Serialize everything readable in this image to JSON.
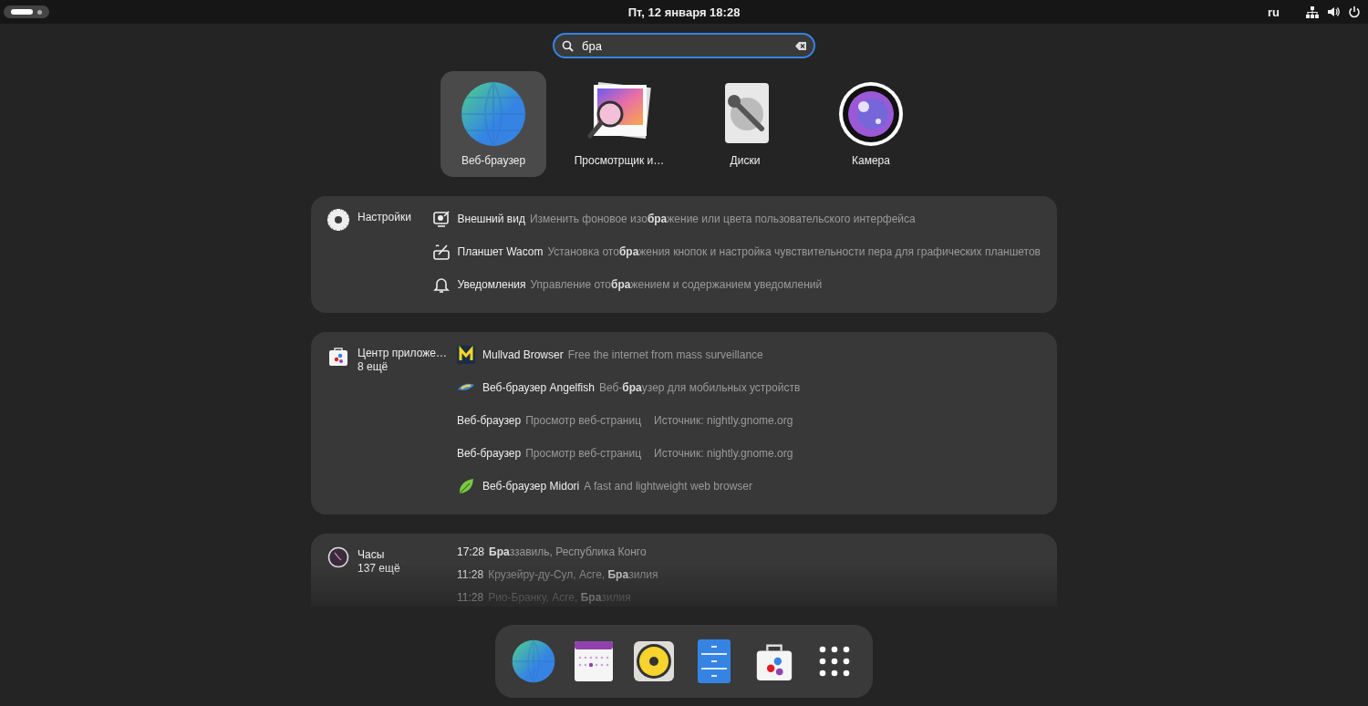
{
  "top_bar": {
    "clock": "Пт, 12 января  18:28",
    "keyboard": "ru"
  },
  "search": {
    "value": "бра"
  },
  "apps": [
    {
      "name": "Веб-браузер",
      "kind": "globe",
      "selected": true
    },
    {
      "name": "Просмотрщик и…",
      "kind": "image",
      "selected": false
    },
    {
      "name": "Диски",
      "kind": "disk",
      "selected": false
    },
    {
      "name": "Камера",
      "kind": "camera",
      "selected": false
    }
  ],
  "sections": [
    {
      "kind": "gear",
      "title": "Настройки",
      "results": [
        {
          "kind": "appearance",
          "title": "Внешний вид",
          "description": "Изменить фоновое изо**бра**жение или цвета пользовательского интерфейса"
        },
        {
          "kind": "tablet",
          "title": "Планшет Wacom",
          "description": "Установка ото**бра**жения кнопок и настройка чувствительности пера для графических планшетов"
        },
        {
          "kind": "bell",
          "title": "Уведомления",
          "description": "Управление ото**бра**жением и содержанием уведомлений"
        }
      ]
    },
    {
      "kind": "bag",
      "title": "Центр приложе…",
      "more": "8 ещё",
      "results": [
        {
          "kind": "mullvad",
          "title": "Mullvad Browser",
          "description": "Free the internet from mass surveillance"
        },
        {
          "kind": "fish",
          "title": "Веб-браузер Angelfish",
          "description": "Веб-**бра**узер для мобильных устройств"
        },
        {
          "kind": "plain",
          "title": "Веб-браузер",
          "description": "Просмотр веб-страниц",
          "source": "Источник: nightly.gnome.org"
        },
        {
          "kind": "plain",
          "title": "Веб-браузер",
          "description": "Просмотр веб-страниц",
          "source": "Источник: nightly.gnome.org"
        },
        {
          "kind": "leaf",
          "title": "Веб-браузер Midori",
          "description": "A fast and lightweight web browser"
        }
      ]
    },
    {
      "kind": "clock",
      "title": "Часы",
      "more": "137 ещё",
      "results": [
        {
          "kind": "plain",
          "title": "17:28",
          "description": "**Бра**ззавиль, Республика Конго"
        },
        {
          "kind": "plain",
          "title": "11:28",
          "description": "Крузейру-ду-Сул, Асге, **Бра**зилия"
        },
        {
          "kind": "plain",
          "title": "11:28",
          "description": "Рио-Бранку, Асге, **Бра**зилия"
        }
      ]
    }
  ],
  "dock": [
    {
      "kind": "globe"
    },
    {
      "kind": "calendar"
    },
    {
      "kind": "speaker"
    },
    {
      "kind": "files"
    },
    {
      "kind": "bag"
    },
    {
      "kind": "grid"
    }
  ]
}
